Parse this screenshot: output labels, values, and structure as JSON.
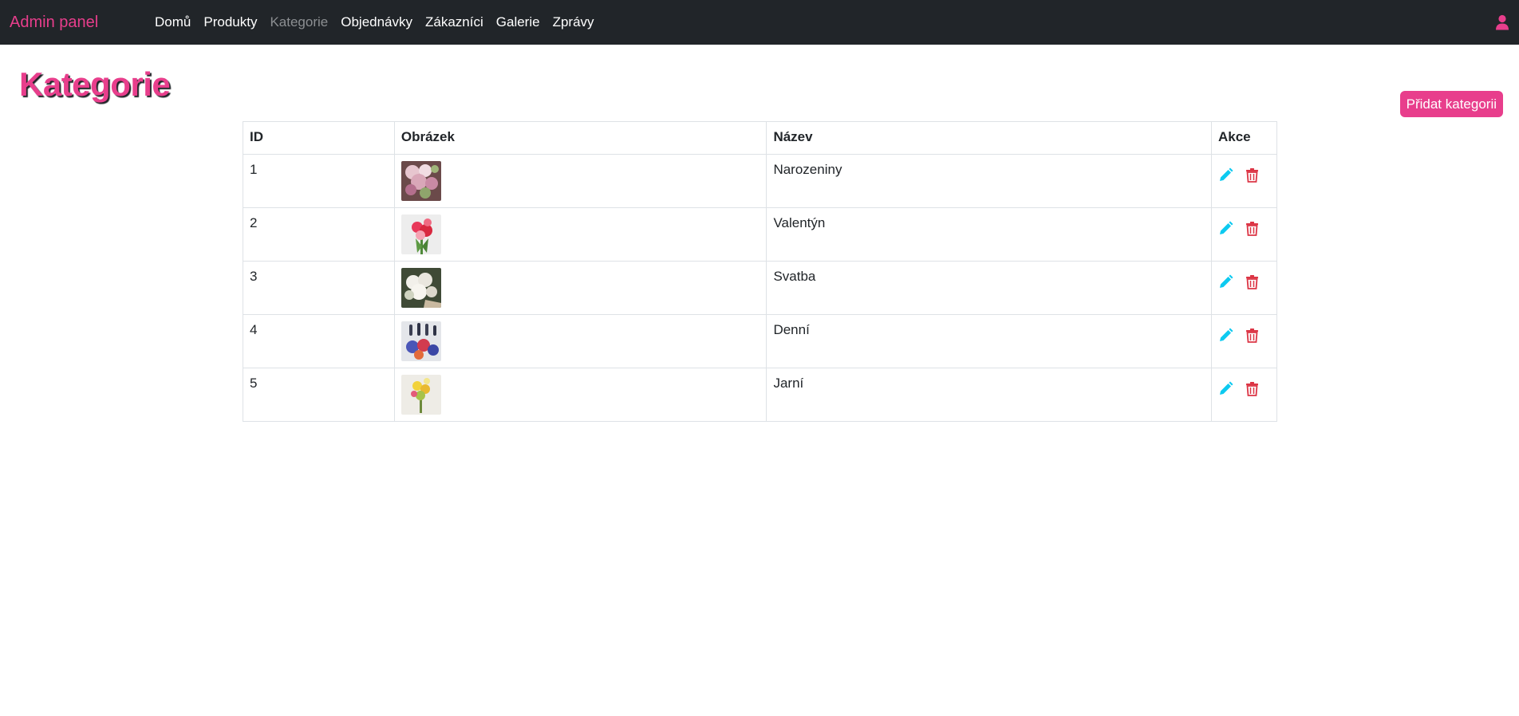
{
  "navbar": {
    "brand": "Admin panel",
    "links": [
      {
        "label": "Domů",
        "active": false
      },
      {
        "label": "Produkty",
        "active": false
      },
      {
        "label": "Kategorie",
        "active": true
      },
      {
        "label": "Objednávky",
        "active": false
      },
      {
        "label": "Zákazníci",
        "active": false
      },
      {
        "label": "Galerie",
        "active": false
      },
      {
        "label": "Zprávy",
        "active": false
      }
    ],
    "user_icon": "user-icon"
  },
  "page": {
    "title": "Kategorie",
    "add_button_label": "Přidat kategorii"
  },
  "table": {
    "headers": {
      "id": "ID",
      "image": "Obrázek",
      "name": "Název",
      "actions": "Akce"
    },
    "rows": [
      {
        "id": "1",
        "name": "Narozeniny"
      },
      {
        "id": "2",
        "name": "Valentýn"
      },
      {
        "id": "3",
        "name": "Svatba"
      },
      {
        "id": "4",
        "name": "Denní"
      },
      {
        "id": "5",
        "name": "Jarní"
      }
    ],
    "edit_icon": "pencil-icon",
    "delete_icon": "trash-icon"
  },
  "colors": {
    "accent": "#e83e8c",
    "navbar_bg": "#212529",
    "edit": "#0dcaf0",
    "delete": "#dc3545"
  }
}
